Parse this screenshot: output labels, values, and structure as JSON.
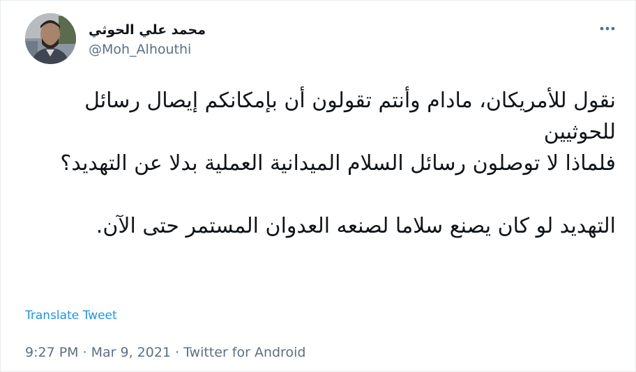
{
  "author": {
    "display_name": "محمد علي الحوثي",
    "handle": "@Moh_Alhouthi",
    "avatar_icon": "profile-photo"
  },
  "more_icon": "more-horizontal-icon",
  "tweet": {
    "paragraph_1": [
      "نقول للأمريكان، مادام وأنتم تقولون  أن بإمكانكم إيصال رسائل للحوثيين",
      "فلماذا لا توصلون رسائل السلام الميدانية العملية بدلا عن التهديد؟"
    ],
    "paragraph_2": "التهديد لو كان يصنع سلاما لصنعه العدوان المستمر حتى الآن."
  },
  "translate_label": "Translate Tweet",
  "meta": {
    "time": "9:27 PM",
    "separator": "·",
    "date": "Mar 9, 2021",
    "source": "Twitter for Android"
  },
  "colors": {
    "link": "#1b95e0",
    "secondary_text": "#5b7083",
    "primary_text": "#0f1419",
    "border": "#e6ecf0"
  }
}
